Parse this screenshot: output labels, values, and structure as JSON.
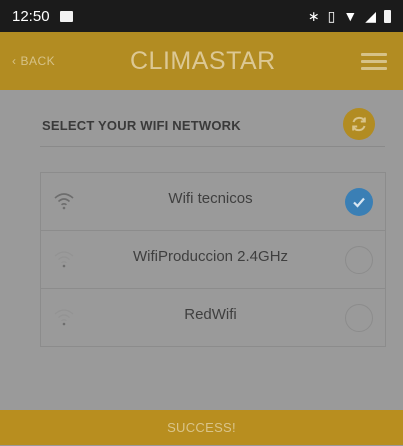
{
  "status_bar": {
    "time": "12:50"
  },
  "app_bar": {
    "back_label": "BACK",
    "brand": "CLIMASTAR"
  },
  "page": {
    "title": "SELECT YOUR WIFI NETWORK"
  },
  "networks": [
    {
      "name": "Wifi tecnicos",
      "selected": true
    },
    {
      "name": "WifiProduccion 2.4GHz",
      "selected": false
    },
    {
      "name": "RedWifi",
      "selected": false
    }
  ],
  "footer": {
    "message": "SUCCESS!"
  },
  "colors": {
    "accent": "#b28c22",
    "overlay_gray": "#9a9a9a",
    "check_blue": "#3a7fb5"
  }
}
